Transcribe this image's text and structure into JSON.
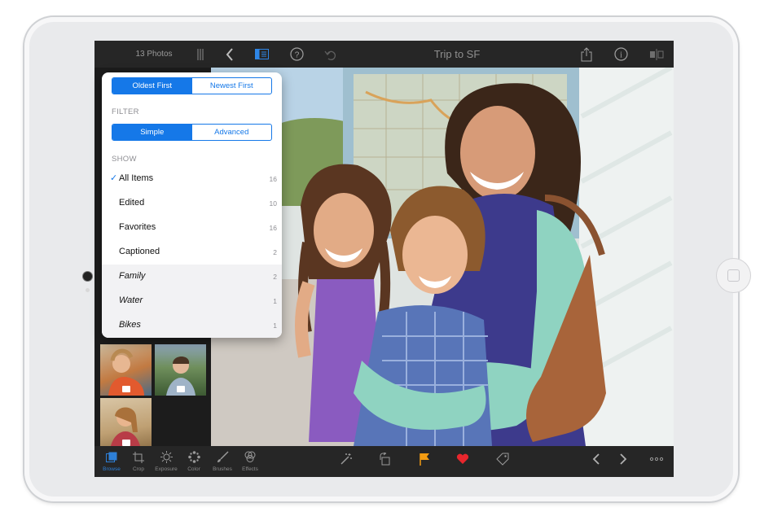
{
  "topbar": {
    "photo_count": "13 Photos",
    "album_title": "Trip to SF",
    "icons": [
      "grip-icon",
      "back-chevron-icon",
      "browser-icon",
      "help-icon",
      "undo-icon",
      "share-icon",
      "info-icon",
      "compare-icon"
    ]
  },
  "popover": {
    "sort": {
      "options": [
        "Oldest First",
        "Newest First"
      ],
      "selected": "Oldest First"
    },
    "filter": {
      "heading": "FILTER",
      "options": [
        "Simple",
        "Advanced"
      ],
      "selected": "Simple"
    },
    "show": {
      "heading": "SHOW",
      "items": [
        {
          "label": "All Items",
          "count": "16",
          "checked": true
        },
        {
          "label": "Edited",
          "count": "10"
        },
        {
          "label": "Favorites",
          "count": "16"
        },
        {
          "label": "Captioned",
          "count": "2"
        },
        {
          "label": "Family",
          "count": "2"
        },
        {
          "label": "Water",
          "count": "1"
        },
        {
          "label": "Bikes",
          "count": "1"
        }
      ]
    }
  },
  "bottombar": {
    "tools": [
      {
        "label": "Browse",
        "active": true
      },
      {
        "label": "Crop"
      },
      {
        "label": "Exposure"
      },
      {
        "label": "Color"
      },
      {
        "label": "Brushes"
      },
      {
        "label": "Effects"
      }
    ],
    "actions": [
      "auto-enhance-icon",
      "rotate-icon",
      "flag-icon",
      "heart-icon",
      "tag-icon",
      "previous-chevron-icon",
      "next-chevron-icon",
      "more-icon"
    ]
  },
  "colors": {
    "accent": "#1578e8",
    "flag": "#f39c12",
    "heart": "#e8262d"
  }
}
